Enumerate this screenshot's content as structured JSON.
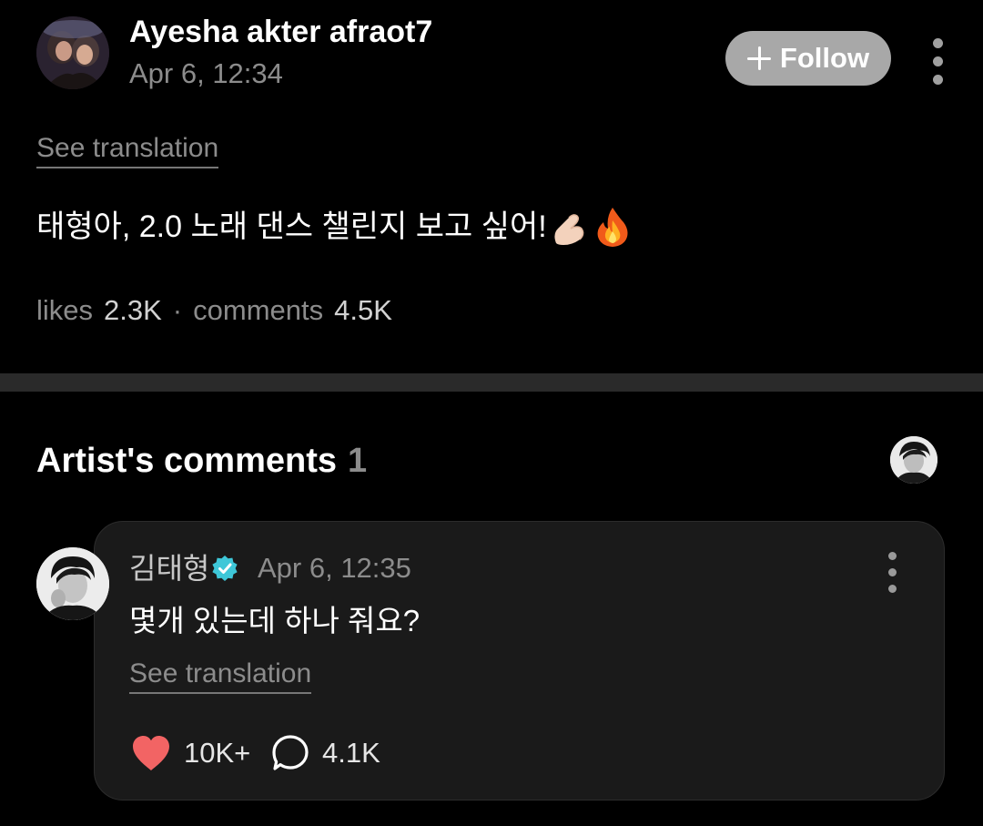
{
  "post": {
    "author": "Ayesha akter afraot7",
    "date": "Apr 6, 12:34",
    "follow_label": "Follow",
    "see_translation": "See translation",
    "text": "태형아, 2.0 노래 댄스 챌린지 보고 싶어!",
    "emojis": [
      "pinching-hand-emoji",
      "fire-emoji"
    ],
    "stats": {
      "likes_label": "likes",
      "likes_value": "2.3K",
      "separator": "·",
      "comments_label": "comments",
      "comments_value": "4.5K"
    }
  },
  "artist_comments": {
    "title": "Artist's comments",
    "count": "1",
    "comment": {
      "author": "김태형",
      "verified": true,
      "date": "Apr 6, 12:35",
      "text": "몇개 있는데 하나 줘요?",
      "see_translation": "See translation",
      "like_count": "10K+",
      "reply_count": "4.1K"
    }
  },
  "colors": {
    "background": "#000000",
    "card": "#1a1a1a",
    "divider": "#2a2a2a",
    "muted_text": "#8c8c8c",
    "follow_button": "#a8a8a8",
    "heart": "#f26464",
    "verified": "#3ec7d8"
  }
}
